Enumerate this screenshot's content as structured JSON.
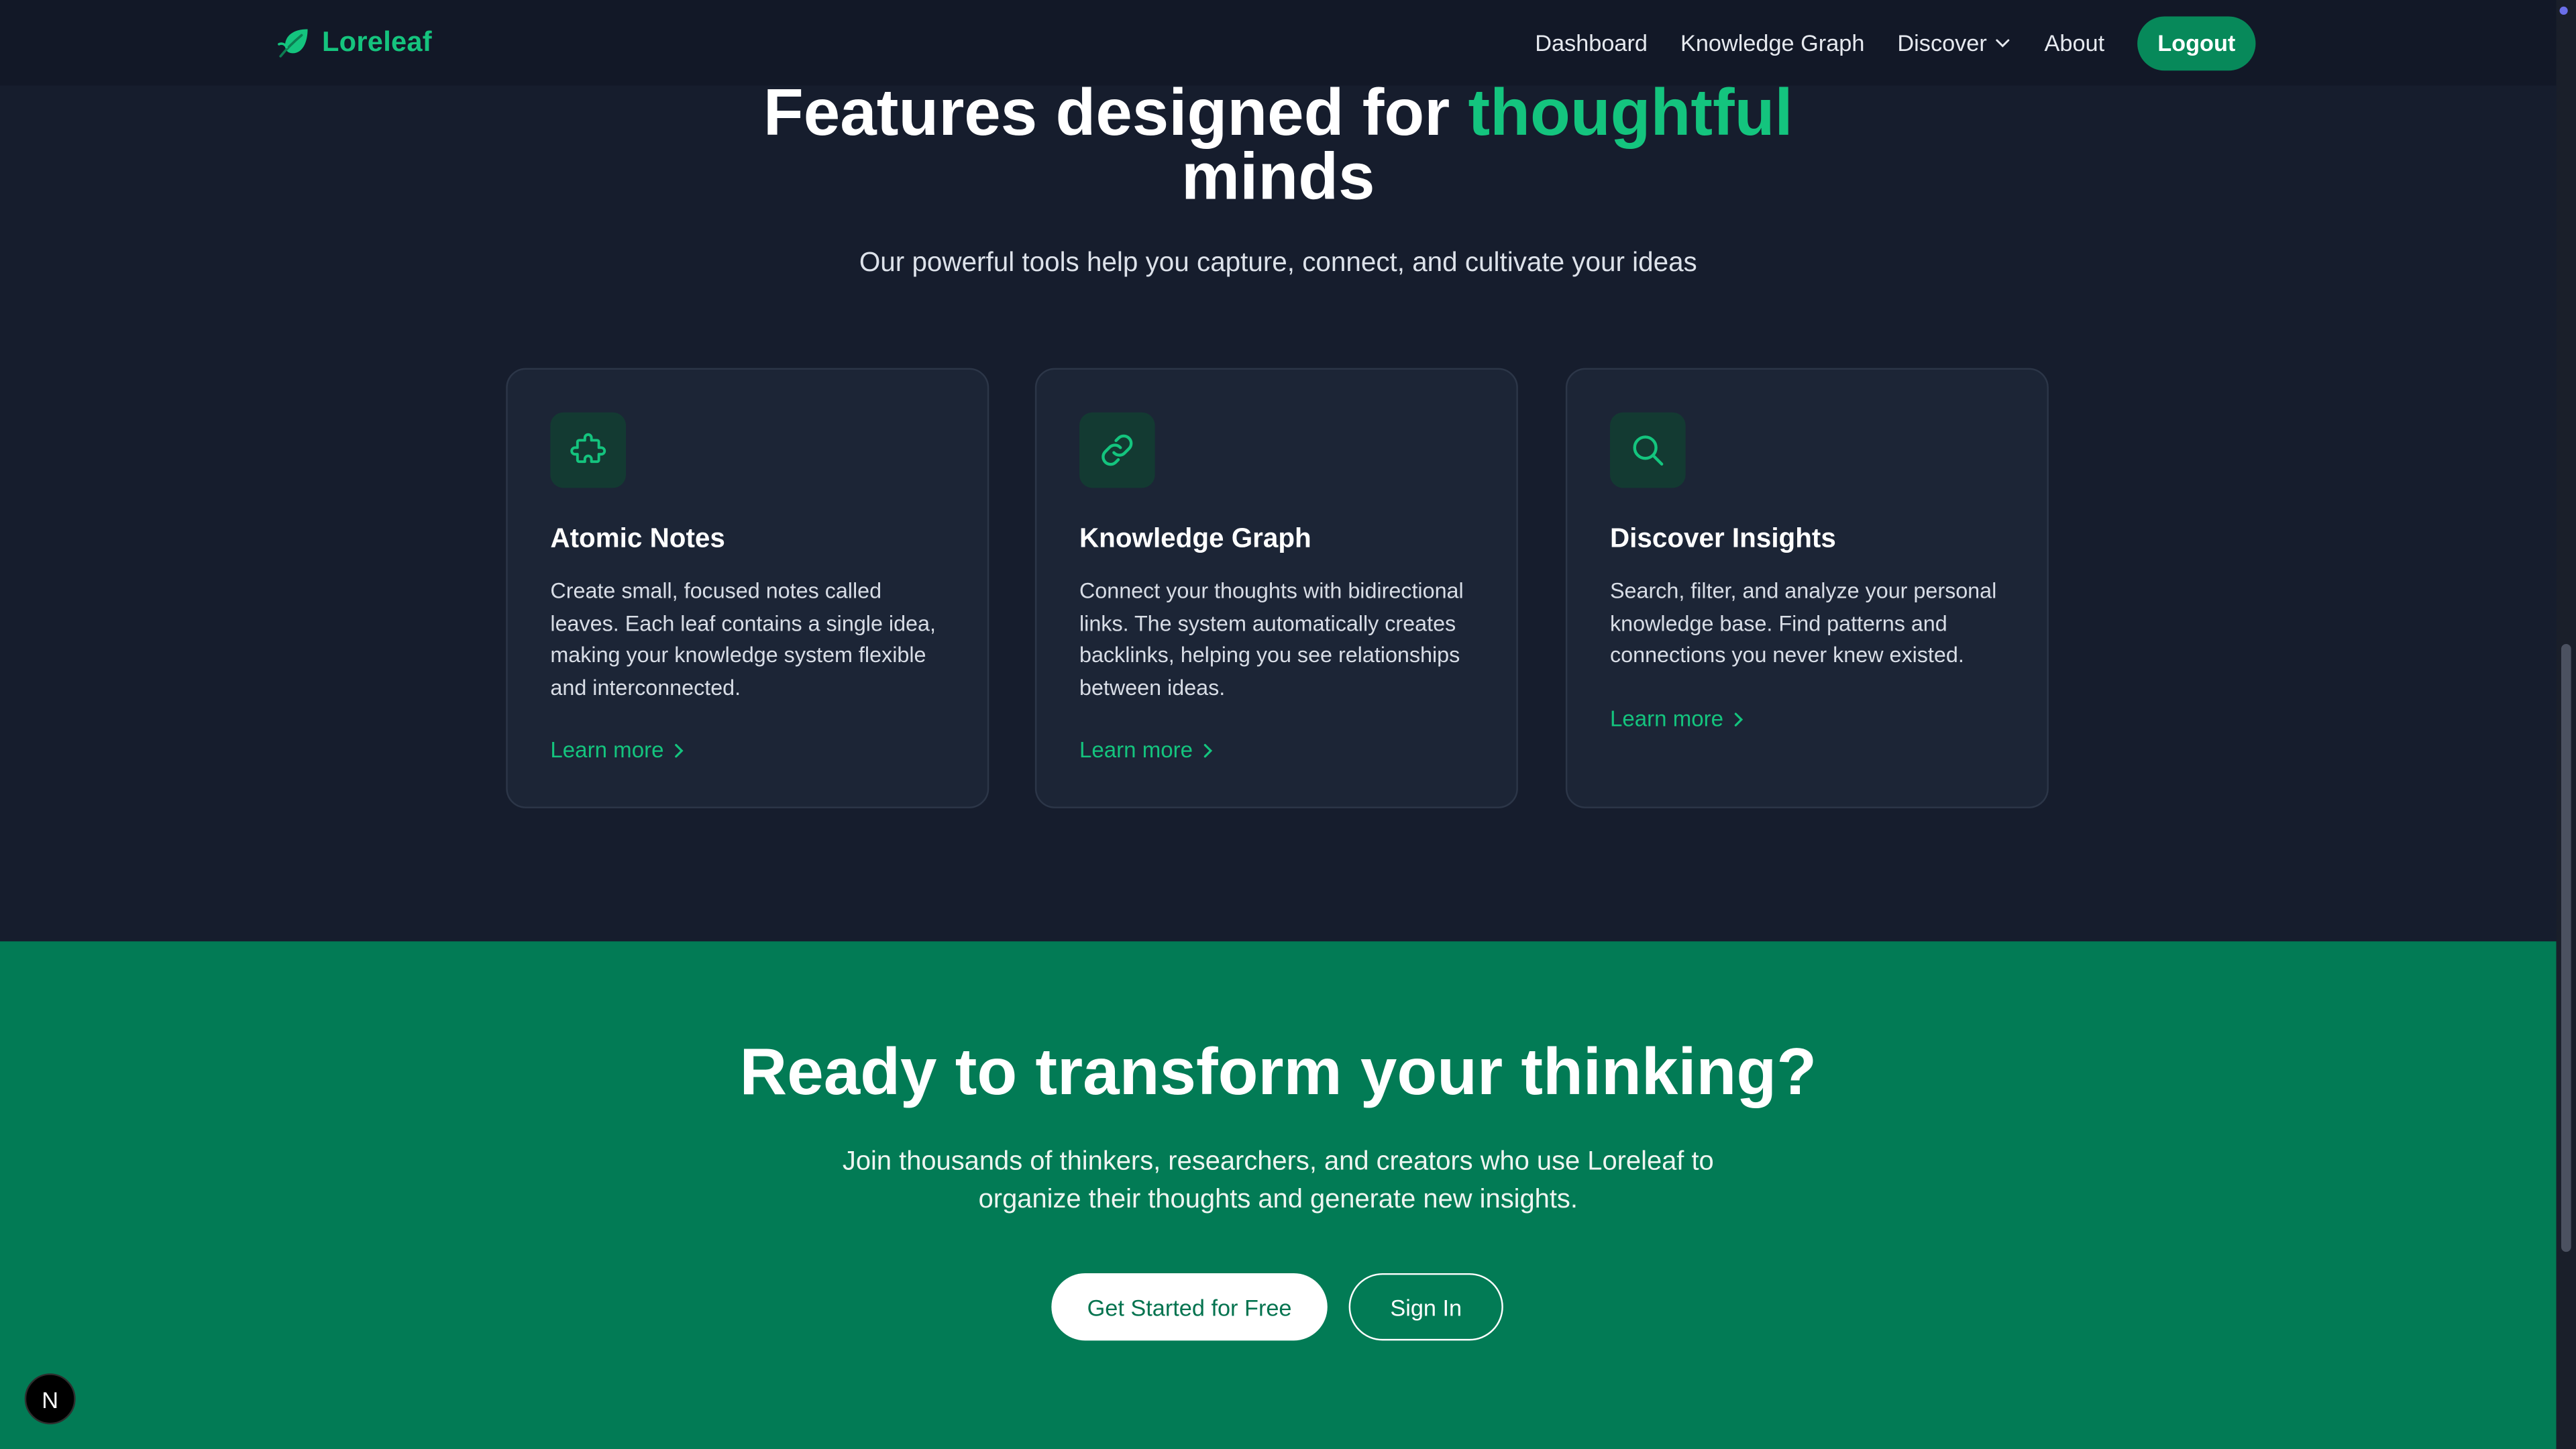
{
  "nav": {
    "brand": "Loreleaf",
    "links": [
      "Dashboard",
      "Knowledge Graph",
      "Discover",
      "About"
    ],
    "logout": "Logout"
  },
  "features": {
    "title_part1": "Features designed for",
    "title_accent": "thoughtful",
    "title_part2": "minds",
    "subtitle": "Our powerful tools help you capture, connect, and cultivate your ideas",
    "cards": [
      {
        "icon": "puzzle-icon",
        "title": "Atomic Notes",
        "description": "Create small, focused notes called leaves. Each leaf contains a single idea, making your knowledge system flexible and interconnected.",
        "link": "Learn more"
      },
      {
        "icon": "link-icon",
        "title": "Knowledge Graph",
        "description": "Connect your thoughts with bidirectional links. The system automatically creates backlinks, helping you see relationships between ideas.",
        "link": "Learn more"
      },
      {
        "icon": "search-icon",
        "title": "Discover Insights",
        "description": "Search, filter, and analyze your personal knowledge base. Find patterns and connections you never knew existed.",
        "link": "Learn more"
      }
    ]
  },
  "cta": {
    "title": "Ready to transform your thinking?",
    "description": "Join thousands of thinkers, researchers, and creators who use Loreleaf to organize their thoughts and generate new insights.",
    "primary_button": "Get Started for Free",
    "secondary_button": "Sign In"
  },
  "dev_badge": "N",
  "colors": {
    "accent": "#14c47e",
    "cta_background": "#027b55",
    "page_background": "#161d2d",
    "card_background": "#1c2536"
  }
}
